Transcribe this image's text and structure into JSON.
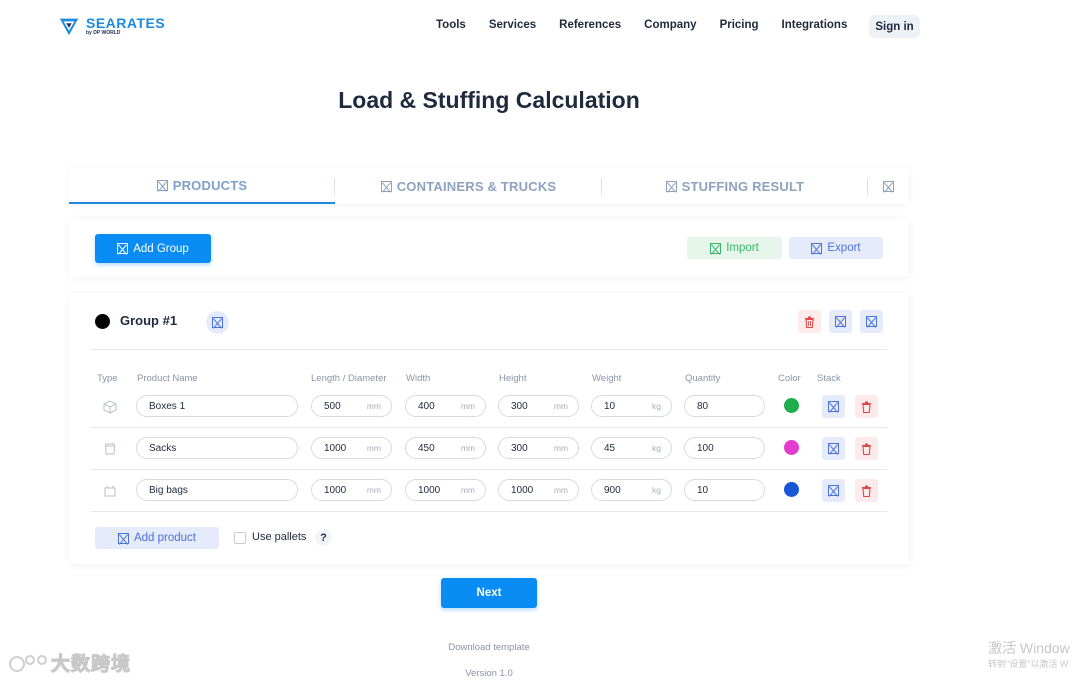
{
  "brand": {
    "name": "SEARATES",
    "sub": "by DP WORLD"
  },
  "nav": {
    "items": [
      "Tools",
      "Services",
      "References",
      "Company",
      "Pricing",
      "Integrations"
    ],
    "signin": "Sign in"
  },
  "page": {
    "title": "Load & Stuffing Calculation"
  },
  "tabs": [
    "PRODUCTS",
    "CONTAINERS & TRUCKS",
    "STUFFING RESULT"
  ],
  "toolbar": {
    "add_group": "Add Group",
    "import": "Import",
    "export": "Export"
  },
  "group": {
    "name": "Group #1",
    "columns": [
      "Type",
      "Product Name",
      "Length / Diameter",
      "Width",
      "Height",
      "Weight",
      "Quantity",
      "Color",
      "Stack"
    ],
    "rows": [
      {
        "type_icon": "box-icon",
        "name": "Boxes 1",
        "length": "500",
        "width": "400",
        "height": "300",
        "weight": "10",
        "quantity": "80",
        "color": "#1fae4b"
      },
      {
        "type_icon": "sack-icon",
        "name": "Sacks",
        "length": "1000",
        "width": "450",
        "height": "300",
        "weight": "45",
        "quantity": "100",
        "color": "#e43ccf"
      },
      {
        "type_icon": "bigbag-icon",
        "name": "Big bags",
        "length": "1000",
        "width": "1000",
        "height": "1000",
        "weight": "900",
        "quantity": "10",
        "color": "#1657d8"
      }
    ],
    "units": {
      "length": "mm",
      "weight": "kg"
    },
    "add_product": "Add product",
    "use_pallets": "Use pallets",
    "help": "?"
  },
  "next": "Next",
  "footer": {
    "download": "Download template",
    "version": "Version 1.0"
  },
  "watermark": {
    "left": "大数跨境",
    "right_line1": "激活 Window",
    "right_line2": "转到\"设置\"以激活 W"
  },
  "colors": {
    "accent": "#0a8cf5",
    "import_green": "#3ab66a",
    "export_blue": "#4a72d8",
    "delete_red": "#e04848"
  }
}
